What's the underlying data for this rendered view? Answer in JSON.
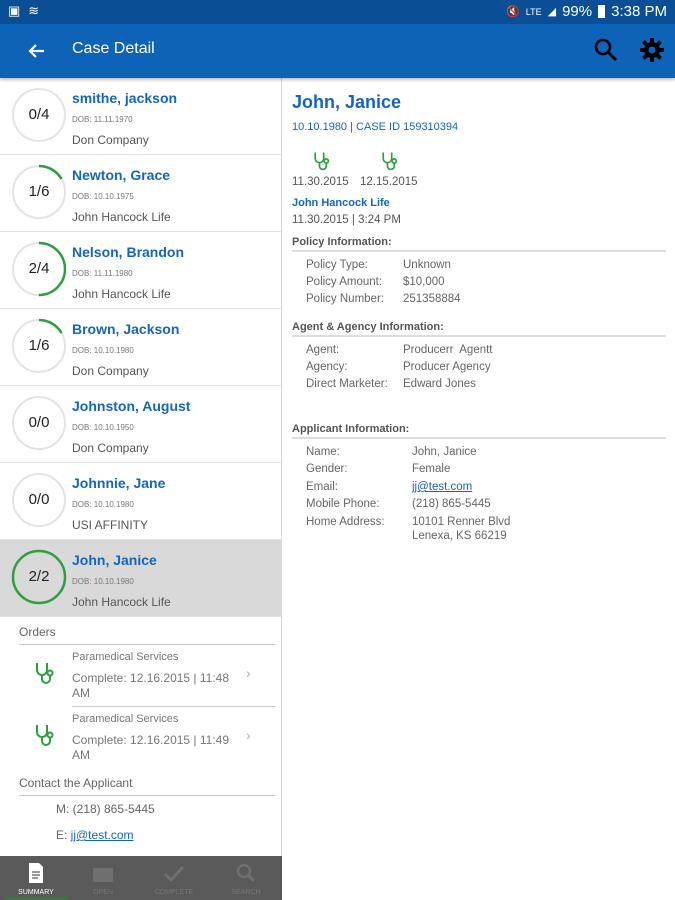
{
  "status_bar": {
    "battery": "99%",
    "time": "3:38 PM",
    "icons": [
      "image-icon",
      "wifi-calling-icon",
      "mute-icon",
      "lte-icon",
      "signal-icon",
      "battery-icon"
    ]
  },
  "app_bar": {
    "title": "Case Detail",
    "icons": [
      "back-arrow-icon",
      "search-icon",
      "gear-icon"
    ]
  },
  "cases": [
    {
      "progress": "0/4",
      "completed": 0,
      "total": 4,
      "name": "smithe, jackson",
      "dob": "DOB: 11.11.1970",
      "company": "Don Company",
      "selected": false
    },
    {
      "progress": "1/6",
      "completed": 1,
      "total": 6,
      "name": "Newton, Grace",
      "dob": "DOB: 10.10.1975",
      "company": "John Hancock Life",
      "selected": false
    },
    {
      "progress": "2/4",
      "completed": 2,
      "total": 4,
      "name": "Nelson, Brandon",
      "dob": "DOB: 11.11.1980",
      "company": "John Hancock Life",
      "selected": false
    },
    {
      "progress": "1/6",
      "completed": 1,
      "total": 6,
      "name": "Brown, Jackson",
      "dob": "DOB: 10.10.1980",
      "company": "Don Company",
      "selected": false
    },
    {
      "progress": "0/0",
      "completed": 0,
      "total": 0,
      "name": "Johnston, August",
      "dob": "DOB: 10.10.1950",
      "company": "Don Company",
      "selected": false
    },
    {
      "progress": "0/0",
      "completed": 0,
      "total": 0,
      "name": "Johnnie, Jane",
      "dob": "DOB: 10.10.1980",
      "company": "USI AFFINITY",
      "selected": false
    },
    {
      "progress": "2/2",
      "completed": 2,
      "total": 2,
      "name": "John, Janice",
      "dob": "DOB: 10.10.1980",
      "company": "John Hancock Life",
      "selected": true
    }
  ],
  "orders": {
    "heading": "Orders",
    "items": [
      {
        "title": "Paramedical Services",
        "status": "Complete: 12.16.2015 | 11:48 AM"
      },
      {
        "title": "Paramedical Services",
        "status": "Complete: 12.16.2015 | 11:49 AM"
      }
    ]
  },
  "contact": {
    "heading": "Contact the Applicant",
    "phone": "M: (218) 865-5445",
    "email_prefix": "E: ",
    "email": "jj@test.com"
  },
  "bottom_nav": [
    {
      "label": "SUMMARY",
      "icon": "document-icon",
      "active": true
    },
    {
      "label": "OPEN",
      "icon": "folder-icon",
      "active": false
    },
    {
      "label": "COMPLETE",
      "icon": "checkmark-icon",
      "active": false
    },
    {
      "label": "SEARCH",
      "icon": "search-icon",
      "active": false
    }
  ],
  "detail": {
    "name": "John, Janice",
    "subtitle": "10.10.1980 | CASE ID 159310394",
    "dates": [
      "11.30.2015",
      "12.15.2015"
    ],
    "carrier": "John Hancock Life",
    "timestamp": "11.30.2015 | 3:24 PM",
    "policy": {
      "heading": "Policy Information:",
      "fields": [
        {
          "label": "Policy Type:",
          "value": "Unknown"
        },
        {
          "label": "Policy Amount:",
          "value": "$10,000"
        },
        {
          "label": "Policy Number:",
          "value": "251358884"
        }
      ]
    },
    "agent": {
      "heading": "Agent & Agency Information:",
      "fields": [
        {
          "label": "Agent:",
          "value": "Producerr  Agentt"
        },
        {
          "label": "Agency:",
          "value": "Producer Agency"
        },
        {
          "label": "Direct Marketer:",
          "value": "Edward Jones"
        }
      ]
    },
    "applicant": {
      "heading": "Applicant Information:",
      "fields": [
        {
          "label": "Name:",
          "value": "John, Janice"
        },
        {
          "label": "Gender:",
          "value": "Female"
        },
        {
          "label": "Email:",
          "value": "jj@test.com"
        },
        {
          "label": "Mobile Phone:",
          "value": "(218) 865-5445"
        },
        {
          "label": "Home Address:",
          "value": "10101 Renner Blvd"
        },
        {
          "label": "",
          "value": "Lenexa, KS 66219"
        }
      ]
    }
  },
  "colors": {
    "status_bar": "#0a4f96",
    "app_bar": "#0d63b8",
    "accent_blue": "#1565c0",
    "progress_green": "#2e9e3e",
    "selected_row": "#d9d9d9",
    "bottom_nav": "#5a5a5a"
  }
}
